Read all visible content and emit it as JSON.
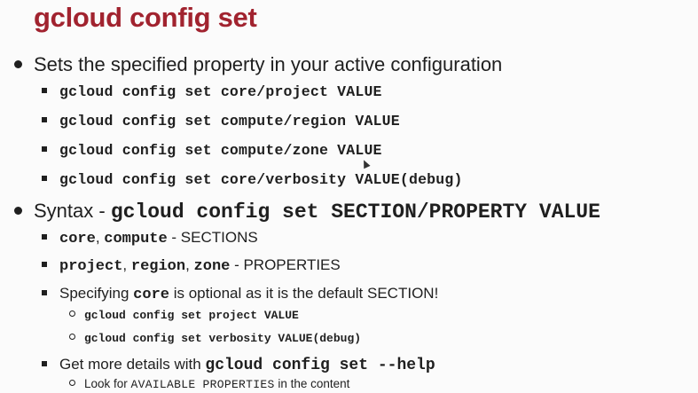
{
  "title": "gcloud config set",
  "bullet1": {
    "text": "Sets the specified property in your active configuration",
    "items": [
      "gcloud config set core/project VALUE",
      "gcloud config set compute/region VALUE",
      "gcloud config set compute/zone VALUE",
      "gcloud config set core/verbosity VALUE(debug)"
    ]
  },
  "bullet2": {
    "prefix": "Syntax - ",
    "syntax": "gcloud config set SECTION/PROPERTY VALUE",
    "sections": {
      "core": "core",
      "sep": ", ",
      "compute": "compute",
      "suffix": " - SECTIONS"
    },
    "properties": {
      "project": "project",
      "sep1": ", ",
      "region": "region",
      "sep2": ", ",
      "zone": "zone",
      "suffix": " - PROPERTIES"
    },
    "optional": {
      "prefix": "Specifying ",
      "core": "core",
      "suffix": " is optional as it is the default SECTION!",
      "items": [
        "gcloud config set project VALUE",
        "gcloud config set verbosity VALUE(debug)"
      ]
    },
    "help": {
      "prefix": "Get more details with ",
      "command": "gcloud config set --help",
      "sub_prefix": "Look for ",
      "sub_code": "AVAILABLE PROPERTIES",
      "sub_suffix": " in the content"
    }
  }
}
